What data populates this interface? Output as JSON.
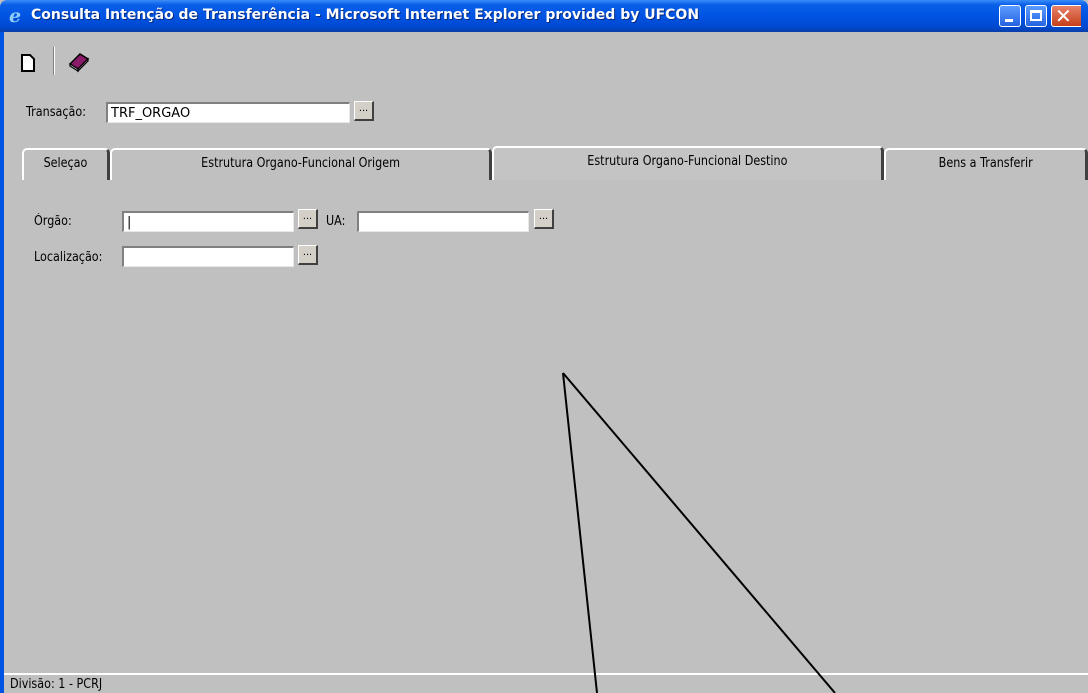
{
  "window": {
    "title": "Consulta Intenção de Transferência - Microsoft Internet Explorer provided by UFCON"
  },
  "toolbar": {
    "new_icon": "new-document-icon",
    "book_icon": "book-icon"
  },
  "transaction": {
    "label": "Transação:",
    "value": "TRF_ORGAO",
    "lookup_label": "..."
  },
  "tabs": [
    {
      "label": "Seleçao"
    },
    {
      "label": "Estrutura Organo-Funcional Origem"
    },
    {
      "label": "Estrutura Organo-Funcional Destino",
      "active": true
    },
    {
      "label": "Bens a Transferir"
    }
  ],
  "form": {
    "orgao_label": "Órgão:",
    "orgao_value": "|",
    "ua_label": "UA:",
    "ua_value": "",
    "localizacao_label": "Localização:",
    "localizacao_value": "",
    "lookup_label": "..."
  },
  "status": {
    "text": "Divisão: 1 - PCRJ"
  },
  "colors": {
    "titlebar": "#0054e3",
    "background": "#c0c0c0"
  }
}
